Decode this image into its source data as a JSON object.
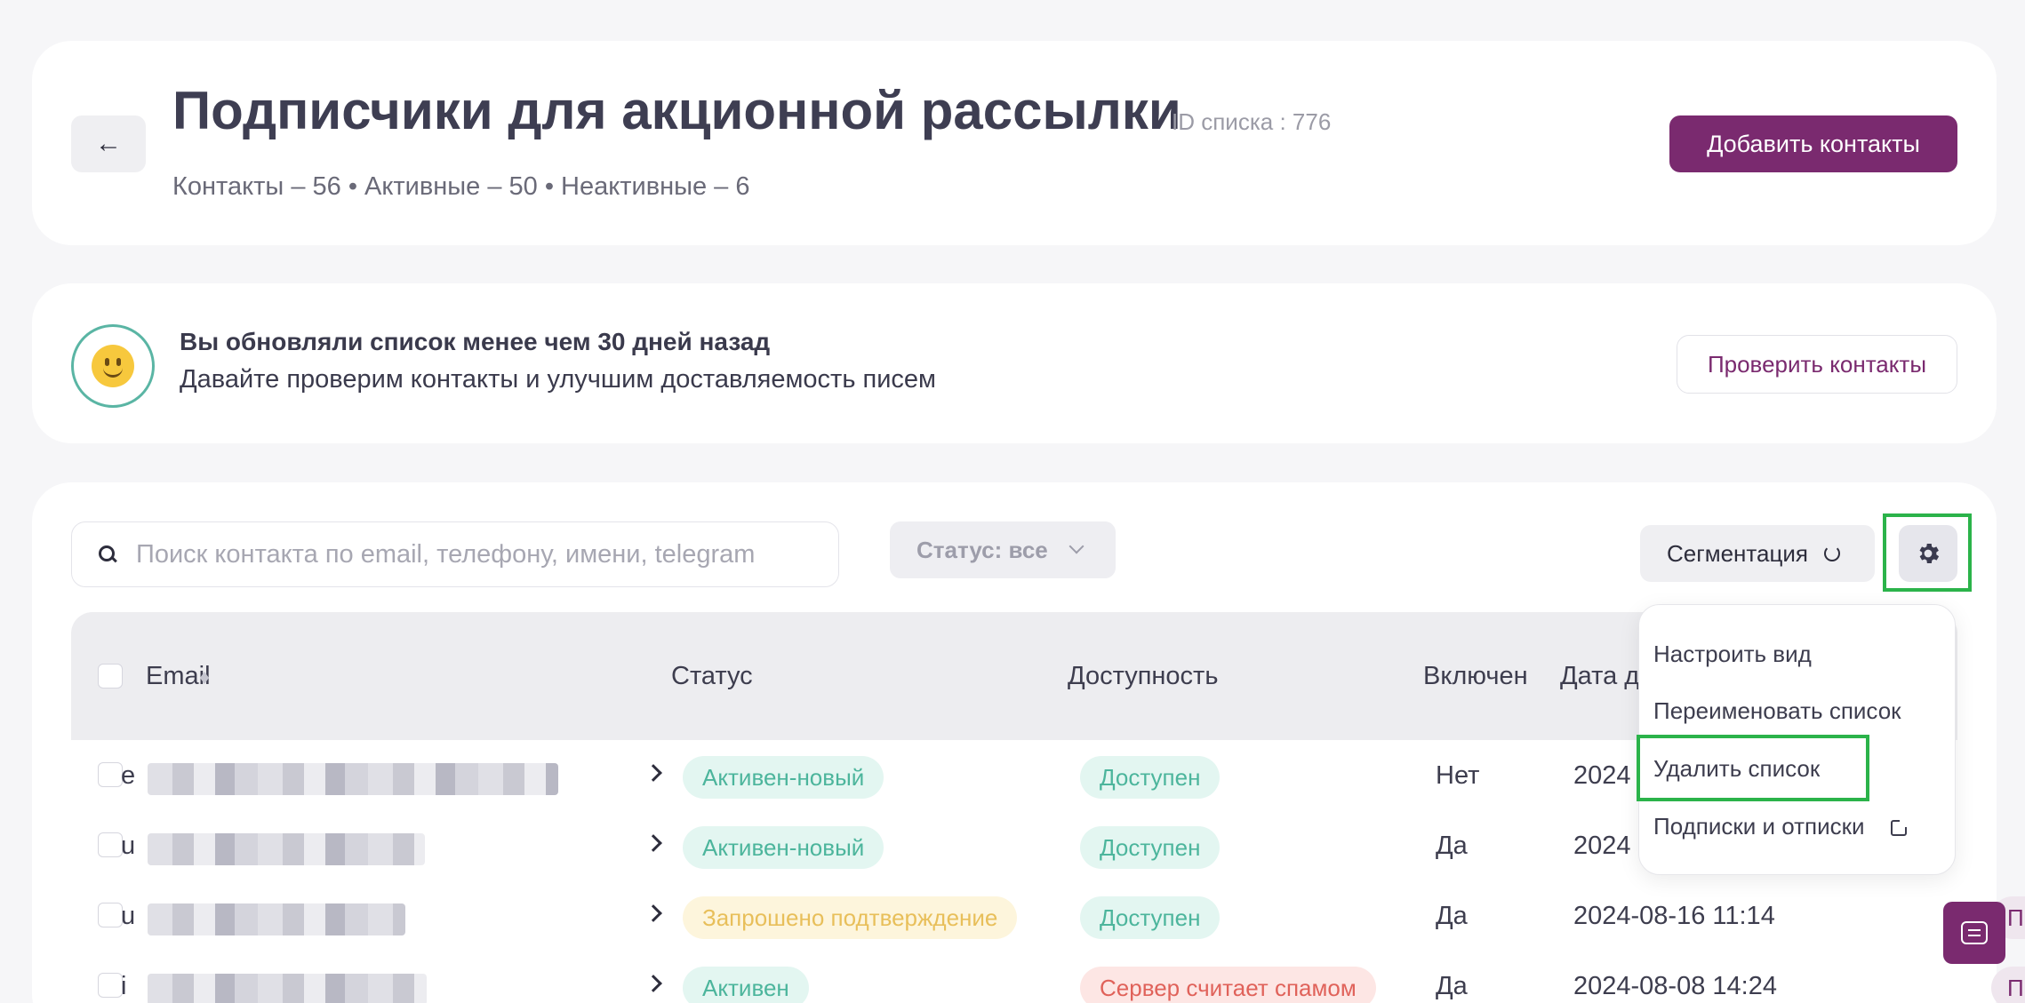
{
  "header": {
    "back_icon": "←",
    "title": "Подписчики для акционной рассылки",
    "list_id": "ID списка : 776",
    "stats": "Контакты – 56 • Активные – 50 • Неактивные – 6",
    "add_button": "Добавить контакты"
  },
  "notice": {
    "icon": "smiley-icon",
    "title": "Вы обновляли список менее чем 30 дней назад",
    "text": "Давайте проверим контакты и улучшим доставляемость писем",
    "check_button": "Проверить контакты"
  },
  "toolbar": {
    "search_placeholder": "Поиск контакта по email, телефону, имени, telegram",
    "status_filter": "Статус: все",
    "segmentation": "Сегментация"
  },
  "table": {
    "columns": [
      "Email",
      "Статус",
      "Доступность",
      "Включен",
      "Дата д"
    ],
    "rows": [
      {
        "email_lead": "e",
        "status": "Активен-новый",
        "availability": "Доступен",
        "enabled": "Нет",
        "date": "2024"
      },
      {
        "email_lead": "u",
        "status": "Активен-новый",
        "availability": "Доступен",
        "enabled": "Да",
        "date": "2024"
      },
      {
        "email_lead": "u",
        "status": "Запрошено подтверждение",
        "availability": "Доступен",
        "enabled": "Да",
        "date": "2024-08-16 11:14"
      },
      {
        "email_lead": "i",
        "status": "Активен",
        "availability": "Сервер считает спамом",
        "enabled": "Да",
        "date": "2024-08-08 14:24"
      }
    ],
    "edge_labels": [
      "П",
      "П"
    ]
  },
  "settings_menu": {
    "items": [
      "Настроить вид",
      "Переименовать список",
      "Удалить список",
      "Подписки и отписки"
    ]
  },
  "colors": {
    "brand": "#7a2a6f",
    "active_bg": "#e3f6f1",
    "active_text": "#4cb59c",
    "pending_bg": "#fdf5dc",
    "pending_text": "#e8bf5a",
    "spam_bg": "#fde6e4",
    "spam_text": "#e0625a",
    "highlight": "#2bb34a"
  }
}
